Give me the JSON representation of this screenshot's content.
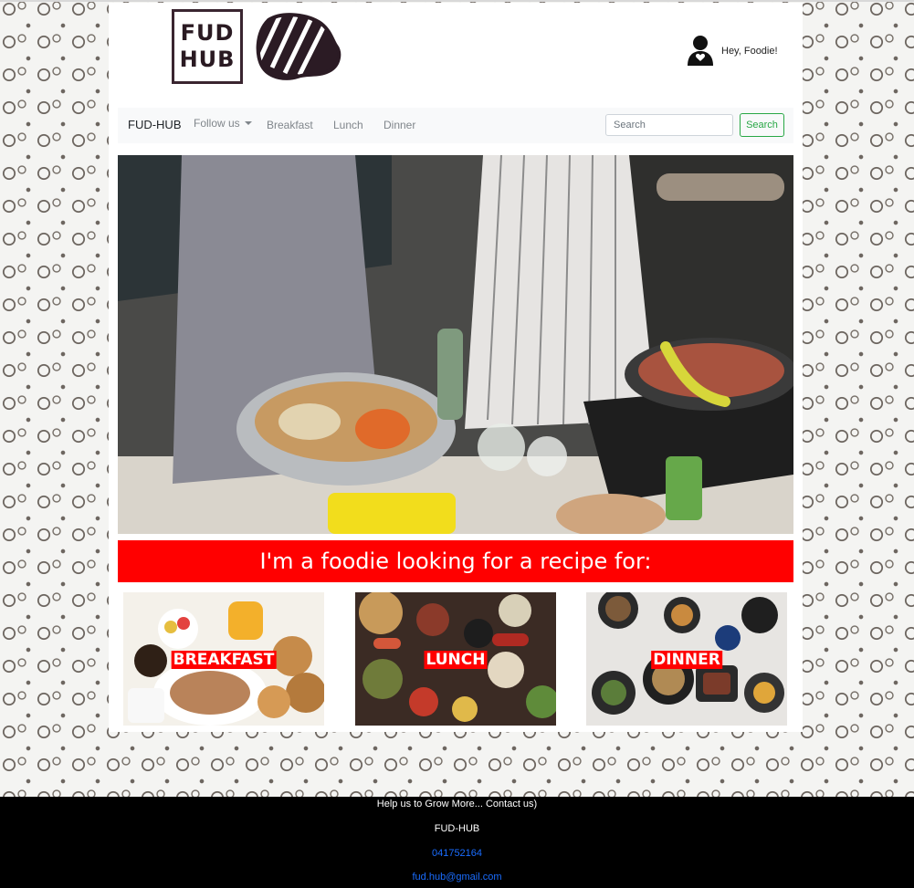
{
  "header": {
    "logo_line1": "FUD",
    "logo_line2": "HUB",
    "greeting": "Hey, Foodie!"
  },
  "navbar": {
    "brand": "FUD-HUB",
    "follow_label": "Follow us",
    "links": [
      "Breakfast",
      "Lunch",
      "Dinner"
    ],
    "search_placeholder": "Search",
    "search_button": "Search"
  },
  "banner": {
    "text": "I'm a foodie looking for a recipe for:"
  },
  "cards": [
    {
      "label": "BREAKFAST"
    },
    {
      "label": "LUNCH"
    },
    {
      "label": "DINNER"
    }
  ],
  "footer": {
    "help": "Help us to Grow More... Contact us)",
    "brand": "FUD-HUB",
    "phone": "041752164",
    "email": "fud.hub@gmail.com"
  },
  "colors": {
    "banner_red": "#ff0000",
    "search_green": "#28a745",
    "link_blue": "#1a6dff",
    "footer_black": "#000000"
  }
}
